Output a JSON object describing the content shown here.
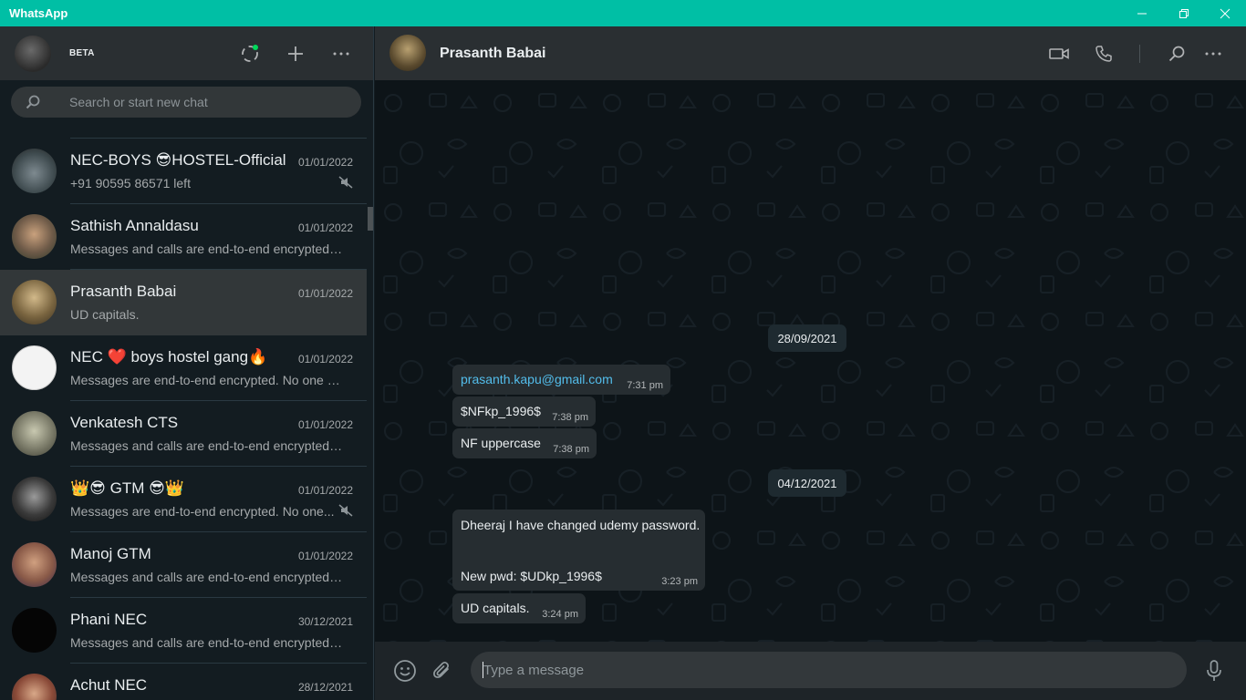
{
  "window": {
    "title": "WhatsApp",
    "controls": {
      "minimize": "—",
      "restore": "❐",
      "close": "✕"
    }
  },
  "sidebar": {
    "beta_label": "BETA",
    "search": {
      "placeholder": "Search or start new chat"
    },
    "chats": [
      {
        "name": "NEC-BOYS 😎HOSTEL-Official",
        "date": "01/01/2022",
        "preview": "+91 90595 86571 left",
        "muted": true
      },
      {
        "name": "Sathish Annaldasu",
        "date": "01/01/2022",
        "preview": "Messages and calls are end-to-end encrypted. ...",
        "muted": false
      },
      {
        "name": "Prasanth Babai",
        "date": "01/01/2022",
        "preview": "UD capitals.",
        "muted": false,
        "active": true
      },
      {
        "name": "NEC ❤️ boys hostel gang🔥",
        "date": "01/01/2022",
        "preview": "Messages are end-to-end encrypted. No one o...",
        "muted": false
      },
      {
        "name": "Venkatesh CTS",
        "date": "01/01/2022",
        "preview": "Messages and calls are end-to-end encrypted. ...",
        "muted": false
      },
      {
        "name": "👑😎 GTM 😎👑",
        "date": "01/01/2022",
        "preview": "Messages are end-to-end encrypted. No one...",
        "muted": true
      },
      {
        "name": "Manoj GTM",
        "date": "01/01/2022",
        "preview": "Messages and calls are end-to-end encrypted. ...",
        "muted": false
      },
      {
        "name": "Phani NEC",
        "date": "30/12/2021",
        "preview": "Messages and calls are end-to-end encrypted. ...",
        "muted": false
      },
      {
        "name": "Achut NEC",
        "date": "28/12/2021",
        "preview": "",
        "muted": false
      }
    ]
  },
  "conversation": {
    "contact_name": "Prasanth Babai",
    "dates": [
      "28/09/2021",
      "04/12/2021"
    ],
    "messages": [
      {
        "text": "prasanth.kapu@gmail.com",
        "time": "7:31 pm"
      },
      {
        "text": "$NFkp_1996$",
        "time": "7:38 pm"
      },
      {
        "text": "NF uppercase",
        "time": "7:38 pm"
      },
      {
        "line1": "Dheeraj I have changed udemy password.",
        "line2": "New pwd:  $UDkp_1996$",
        "time": "3:23 pm"
      },
      {
        "text": "UD capitals.",
        "time": "3:24 pm"
      }
    ]
  },
  "composer": {
    "placeholder": "Type a message"
  },
  "colors": {
    "accent": "#00bfa5",
    "bubble": "#262d31",
    "link": "#53bdeb"
  }
}
